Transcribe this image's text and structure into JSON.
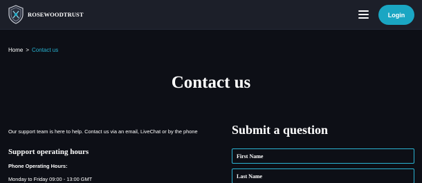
{
  "header": {
    "brand": "ROSEWOODTRUST",
    "login_label": "Login"
  },
  "breadcrumb": {
    "home": "Home",
    "separator": ">",
    "current": "Contact us"
  },
  "page": {
    "title": "Contact us"
  },
  "support": {
    "intro": "Our support team is here to help.  Contact us via an email, LiveChat or by the phone",
    "heading": "Support operating hours",
    "phone_hours_label": "Phone Operating Hours:",
    "hours": "Monday to Friday 09:00 - 13:00 GMT"
  },
  "form": {
    "heading": "Submit a question",
    "first_name_placeholder": "First Name",
    "last_name_placeholder": "Last Name"
  },
  "colors": {
    "accent": "#1aa6c3",
    "header_bg": "#1c1f29",
    "page_bg": "#0d0f16"
  },
  "icons": {
    "logo": "shield-crest-icon",
    "menu": "hamburger-menu-icon",
    "breadcrumb_separator": "chevron-right-icon"
  }
}
